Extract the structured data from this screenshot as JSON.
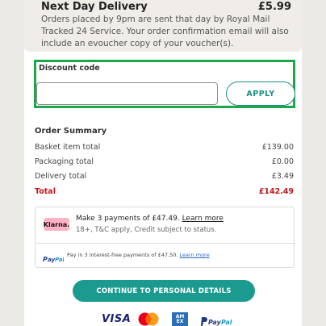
{
  "delivery": {
    "title": "Next Day Delivery",
    "price": "£5.99",
    "description": "Orders placed by 9pm are sent that day by Royal Mail Tracked 24 Service. Your order confirmation email will also include an evoucher copy of your voucher(s)."
  },
  "discount": {
    "label": "Discount code",
    "input_value": "",
    "apply_label": "APPLY"
  },
  "summary": {
    "title": "Order Summary",
    "rows": [
      {
        "label": "Basket item total",
        "value": "£139.00"
      },
      {
        "label": "Packaging total",
        "value": "£0.00"
      },
      {
        "label": "Delivery total",
        "value": "£3.49"
      },
      {
        "label": "Total",
        "value": "£142.49"
      }
    ]
  },
  "klarna": {
    "badge": "Klarna.",
    "line1_prefix": "Make 3 payments of £47.49.",
    "line1_link": "Learn more",
    "line2": "18+, T&C apply, Credit subject to status."
  },
  "paypal_offer": {
    "brand": "PayPal",
    "text": "Pay in 3 interest-free payments of £47.50.",
    "link": "Learn more"
  },
  "continue_label": "CONTINUE TO PERSONAL DETAILS",
  "payment_logos": {
    "visa": "VISA",
    "amex_top": "AM",
    "amex_bottom": "EX",
    "paypal": "PayPal"
  },
  "colors": {
    "accent_teal": "#1b9b8f",
    "highlight_green": "#1aa84b",
    "total_red": "#c4161c",
    "klarna_pink": "#ffb3c7"
  }
}
